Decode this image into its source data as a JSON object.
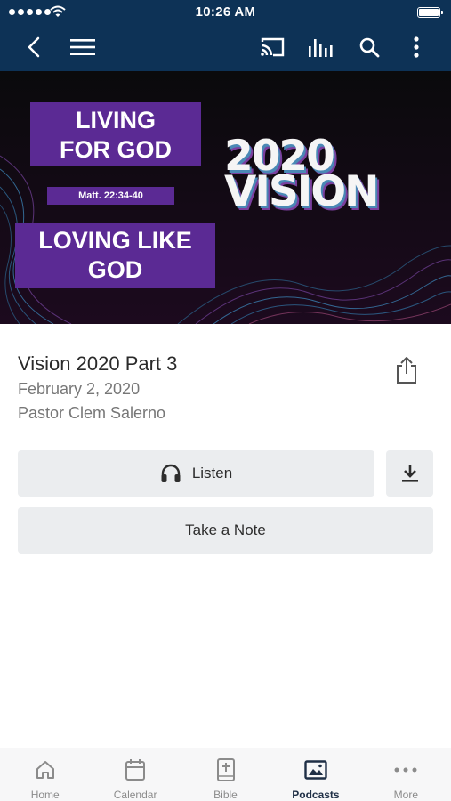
{
  "status_bar": {
    "time": "10:26 AM"
  },
  "header": {
    "background": "#0d3256"
  },
  "artwork": {
    "box1_line1": "LIVING",
    "box1_line2": "FOR GOD",
    "scripture": "Matt. 22:34-40",
    "box3_line1": "LOVING LIKE",
    "box3_line2": "GOD",
    "series_line1": "2020",
    "series_line2": "VISION",
    "accent": "#5b2a94"
  },
  "sermon": {
    "title": "Vision 2020 Part 3",
    "date": "February 2, 2020",
    "speaker": "Pastor Clem Salerno"
  },
  "actions": {
    "listen_label": "Listen",
    "note_label": "Take a Note"
  },
  "tabs": [
    {
      "label": "Home",
      "icon": "home-icon"
    },
    {
      "label": "Calendar",
      "icon": "calendar-icon"
    },
    {
      "label": "Bible",
      "icon": "bible-icon"
    },
    {
      "label": "Podcasts",
      "icon": "podcasts-icon",
      "active": true
    },
    {
      "label": "More",
      "icon": "more-icon"
    }
  ]
}
